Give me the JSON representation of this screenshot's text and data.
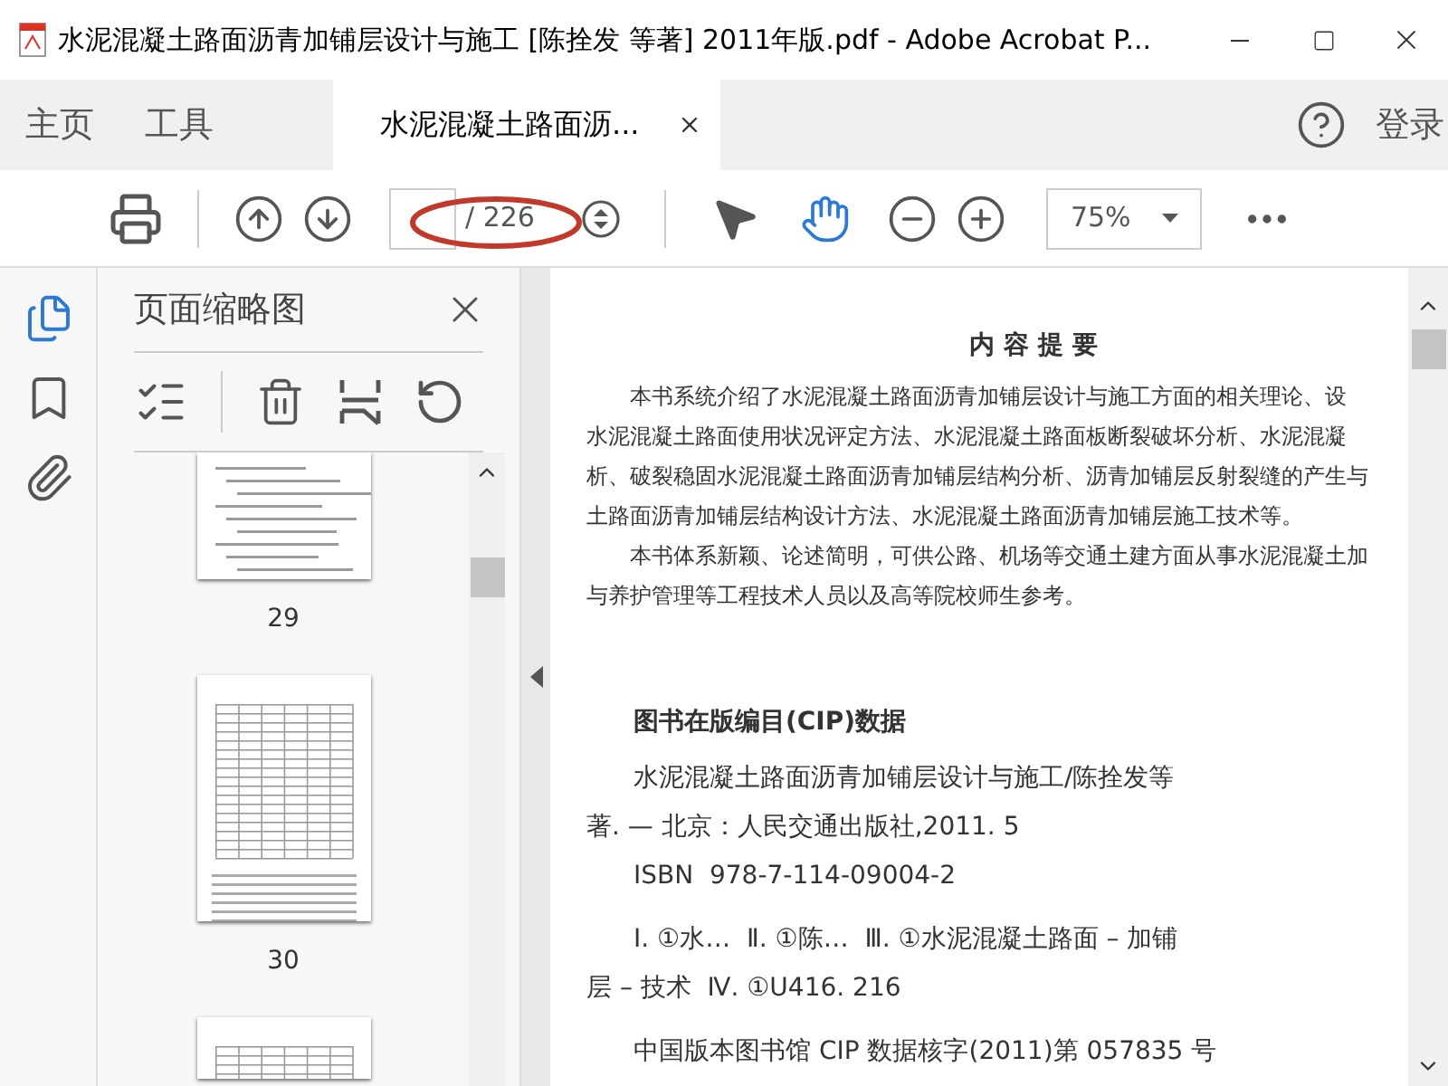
{
  "window": {
    "title": "水泥混凝土路面沥青加铺层设计与施工 [陈拴发 等著] 2011年版.pdf - Adobe Acrobat P..."
  },
  "nav_tabs": [
    {
      "label": "主页",
      "selected": false
    },
    {
      "label": "工具",
      "selected": false
    },
    {
      "label": "水泥混凝土路面沥...",
      "selected": true
    }
  ],
  "account": {
    "label": "登录"
  },
  "toolbar": {
    "page_total": "/ 226",
    "zoom": "75%",
    "tools": [
      {
        "kind": "select",
        "selected": false
      },
      {
        "kind": "hand",
        "selected": true
      }
    ]
  },
  "side_rail": [
    {
      "kind": "pages",
      "selected": true
    },
    {
      "kind": "bookmarks",
      "selected": false
    },
    {
      "kind": "attachments",
      "selected": false
    }
  ],
  "thumbnails_panel": {
    "title": "页面缩略图",
    "pages": [
      {
        "label": "29",
        "kind": "text"
      },
      {
        "label": "30",
        "kind": "table"
      },
      {
        "kind": "table"
      }
    ]
  },
  "document": {
    "heading": "内 容 提 要",
    "summary_paragraphs": [
      [
        "本书系统介绍了水泥混凝土路面沥青加铺层设计与施工方面的相关理论、设",
        "水泥混凝土路面使用状况评定方法、水泥混凝土路面板断裂破坏分析、水泥混凝",
        "析、破裂稳固水泥混凝土路面沥青加铺层结构分析、沥青加铺层反射裂缝的产生与",
        "土路面沥青加铺层结构设计方法、水泥混凝土路面沥青加铺层施工技术等。"
      ],
      [
        "本书体系新颖、论述简明，可供公路、机场等交通土建方面从事水泥混凝土加",
        "与养护管理等工程技术人员以及高等院校师生参考。"
      ]
    ],
    "cip_heading": "图书在版编目(CIP)数据",
    "cip_groups": [
      [
        [
          "水泥混凝土路面沥青加铺层设计与施工/陈拴发等",
          "著. — 北京：人民交通出版社,2011. 5"
        ],
        [
          "ISBN  978-7-114-09004-2"
        ]
      ],
      [
        [
          "Ⅰ. ①水…  Ⅱ. ①陈…  Ⅲ. ①水泥混凝土路面 – 加铺",
          "层 – 技术  Ⅳ. ①U416. 216"
        ]
      ],
      [
        [
          "中国版本图书馆 CIP 数据核字(2011)第 057835 号"
        ]
      ]
    ]
  }
}
